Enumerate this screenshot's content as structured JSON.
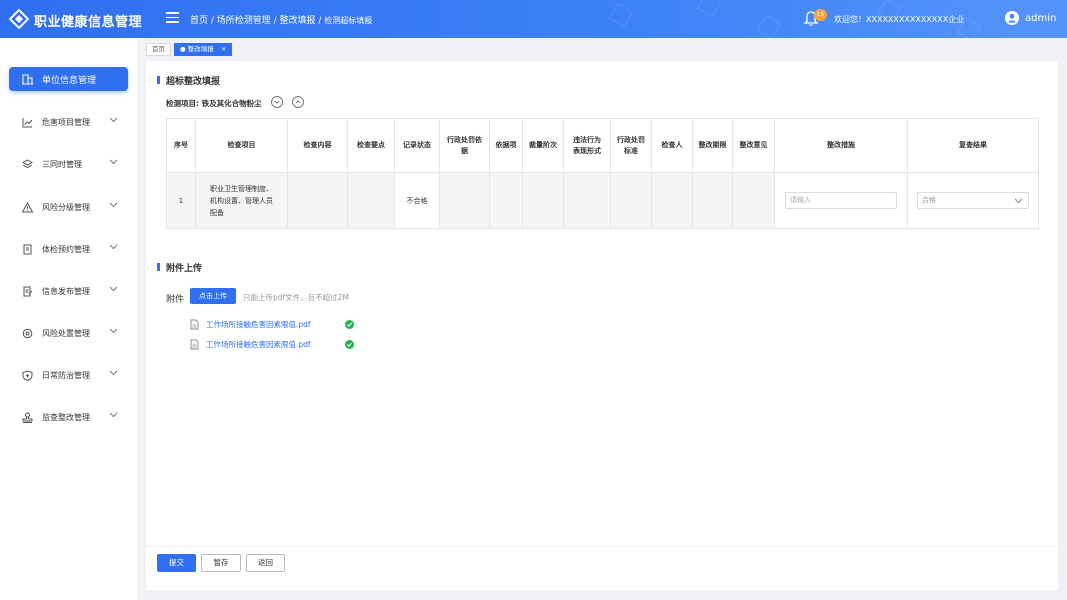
{
  "header": {
    "app_title": "职业健康信息管理",
    "breadcrumb_main": "首页 / 场所检测管理 / 整改填报 / ",
    "breadcrumb_last": "检测超标填报",
    "notification_count": "15",
    "welcome_text": "欢迎您！XXXXXXXXXXXXXXX企业",
    "username": "admin",
    "accent_color": "#2f6ff0"
  },
  "sidebar": {
    "items": [
      {
        "label": "单位信息管理",
        "icon": "building-icon"
      },
      {
        "label": "危害项目管理",
        "icon": "line-chart-icon"
      },
      {
        "label": "三同时管理",
        "icon": "layers-icon"
      },
      {
        "label": "风险分级管理",
        "icon": "warning-icon"
      },
      {
        "label": "体检预约管理",
        "icon": "clipboard-icon"
      },
      {
        "label": "信息发布管理",
        "icon": "edit-doc-icon"
      },
      {
        "label": "风险处置管理",
        "icon": "settings-refresh-icon"
      },
      {
        "label": "日常防治管理",
        "icon": "shield-icon"
      },
      {
        "label": "监查整改管理",
        "icon": "stamp-icon"
      }
    ]
  },
  "tabs": [
    {
      "label": "首页"
    },
    {
      "label": "● 整改填报",
      "close": "×"
    }
  ],
  "form": {
    "section1_title": "超标整改填报",
    "project_label": "检测项目: 铁及其化合物粉尘",
    "columns": [
      "序号",
      "检查项目",
      "检查内容",
      "检查要点",
      "记录状态",
      "行政处罚依据",
      "依据项",
      "裁量阶次",
      "违法行为表现形式",
      "行政处罚标准",
      "检查人",
      "整改期限",
      "整改意见",
      "整改措施",
      "复查结果"
    ],
    "row": {
      "index": "1",
      "item": "职业卫生管理制度、机构设置、管理人员配备",
      "status": "不合格",
      "measure_placeholder": "请输入",
      "recheck_value": "合格"
    },
    "section2_title": "附件上传",
    "attach_label": "附件",
    "upload_button": "点击上传",
    "upload_hint": "只能上传pdf文件，且不超过2M",
    "files": [
      {
        "name": "工作场所接触危害因素限值.pdf"
      },
      {
        "name": "工作场所接触危害因素限值.pdf"
      }
    ],
    "success_color": "#1fb44d"
  },
  "actions": {
    "submit": "提交",
    "save_draft": "暂存",
    "back": "返回"
  }
}
